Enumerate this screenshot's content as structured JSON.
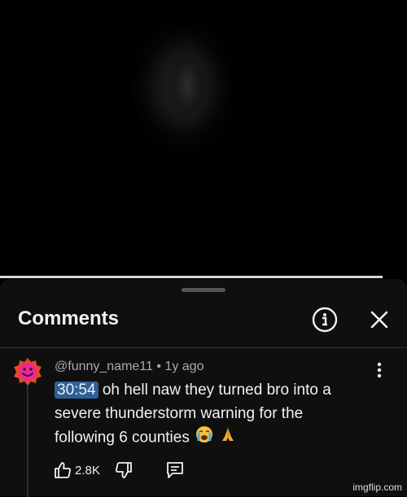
{
  "panel": {
    "title": "Comments"
  },
  "comment": {
    "author": "@funny_name11",
    "separator": "•",
    "age": "1y ago",
    "timestamp": "30:54",
    "text": " oh hell naw they turned bro into a severe thunderstorm warning for the following 6 counties",
    "emojis": [
      "crying-face",
      "folded-hands"
    ],
    "like_count": "2.8K"
  },
  "icons": {
    "info": "info-icon",
    "close": "close-icon",
    "more": "more-vert-icon",
    "like": "thumbs-up-icon",
    "dislike": "thumbs-down-icon",
    "reply": "reply-icon",
    "avatar": "avatar"
  },
  "colors": {
    "sheet_background": "#0f0f0f",
    "timestamp_highlight": "#2f5f95",
    "avatar_outer": "#e64a1a",
    "avatar_inner": "#e8289c"
  },
  "watermark": "imgflip.com"
}
